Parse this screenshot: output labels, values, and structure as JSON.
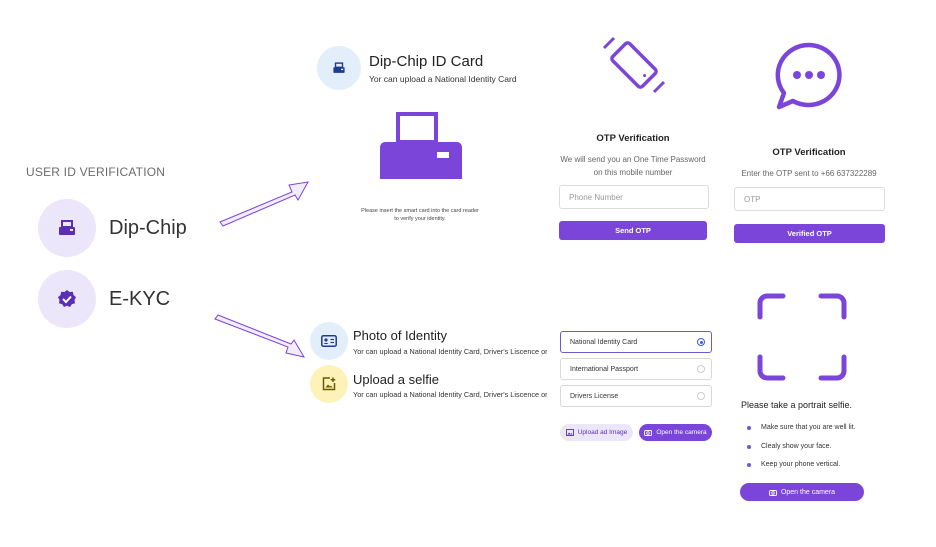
{
  "left": {
    "section_title": "USER ID VERIFICATION",
    "methods": [
      {
        "label": "Dip-Chip",
        "icon": "card-reader-icon"
      },
      {
        "label": "E-KYC",
        "icon": "verified-badge-icon"
      }
    ]
  },
  "dipchip": {
    "title": "Dip-Chip ID Card",
    "subtitle": "Yor can upload a National Identity Card",
    "instruction_line1": "Please insert the smart card into the card reader",
    "instruction_line2": "to verify your identity."
  },
  "otp_send": {
    "title": "OTP Verification",
    "desc_line1": "We will send you an One Time Password",
    "desc_line2": "on this mobile number",
    "phone_placeholder": "Phone Number",
    "button": "Send OTP"
  },
  "otp_verify": {
    "title": "OTP Verification",
    "desc": "Enter the OTP sent to +66 637322289",
    "otp_placeholder": "OTP",
    "button": "Verified OTP"
  },
  "ekyc": {
    "photo_title": "Photo of Identity",
    "photo_sub": "Yor can upload a National Identity Card, Driver's Liscence or I",
    "selfie_title": "Upload a selfie",
    "selfie_sub": "Yor can upload a National Identity Card, Driver's Liscence or I"
  },
  "documents": {
    "options": [
      "National Identity Card",
      "International Passport",
      "Drivers License"
    ],
    "selected_index": 0,
    "upload_button": "Upload ad Image",
    "camera_button": "Open the camera"
  },
  "selfie": {
    "title": "Please take a portrait selfie.",
    "tips": [
      "Make sure that you are well lit.",
      "Clealy show your face.",
      "Keep your phone vertical."
    ],
    "camera_button": "Open the camera"
  },
  "colors": {
    "accent": "#7b45d9",
    "light_purple": "#ece6fb",
    "light_blue": "#e3eefb",
    "light_yellow": "#fdf3b8"
  }
}
